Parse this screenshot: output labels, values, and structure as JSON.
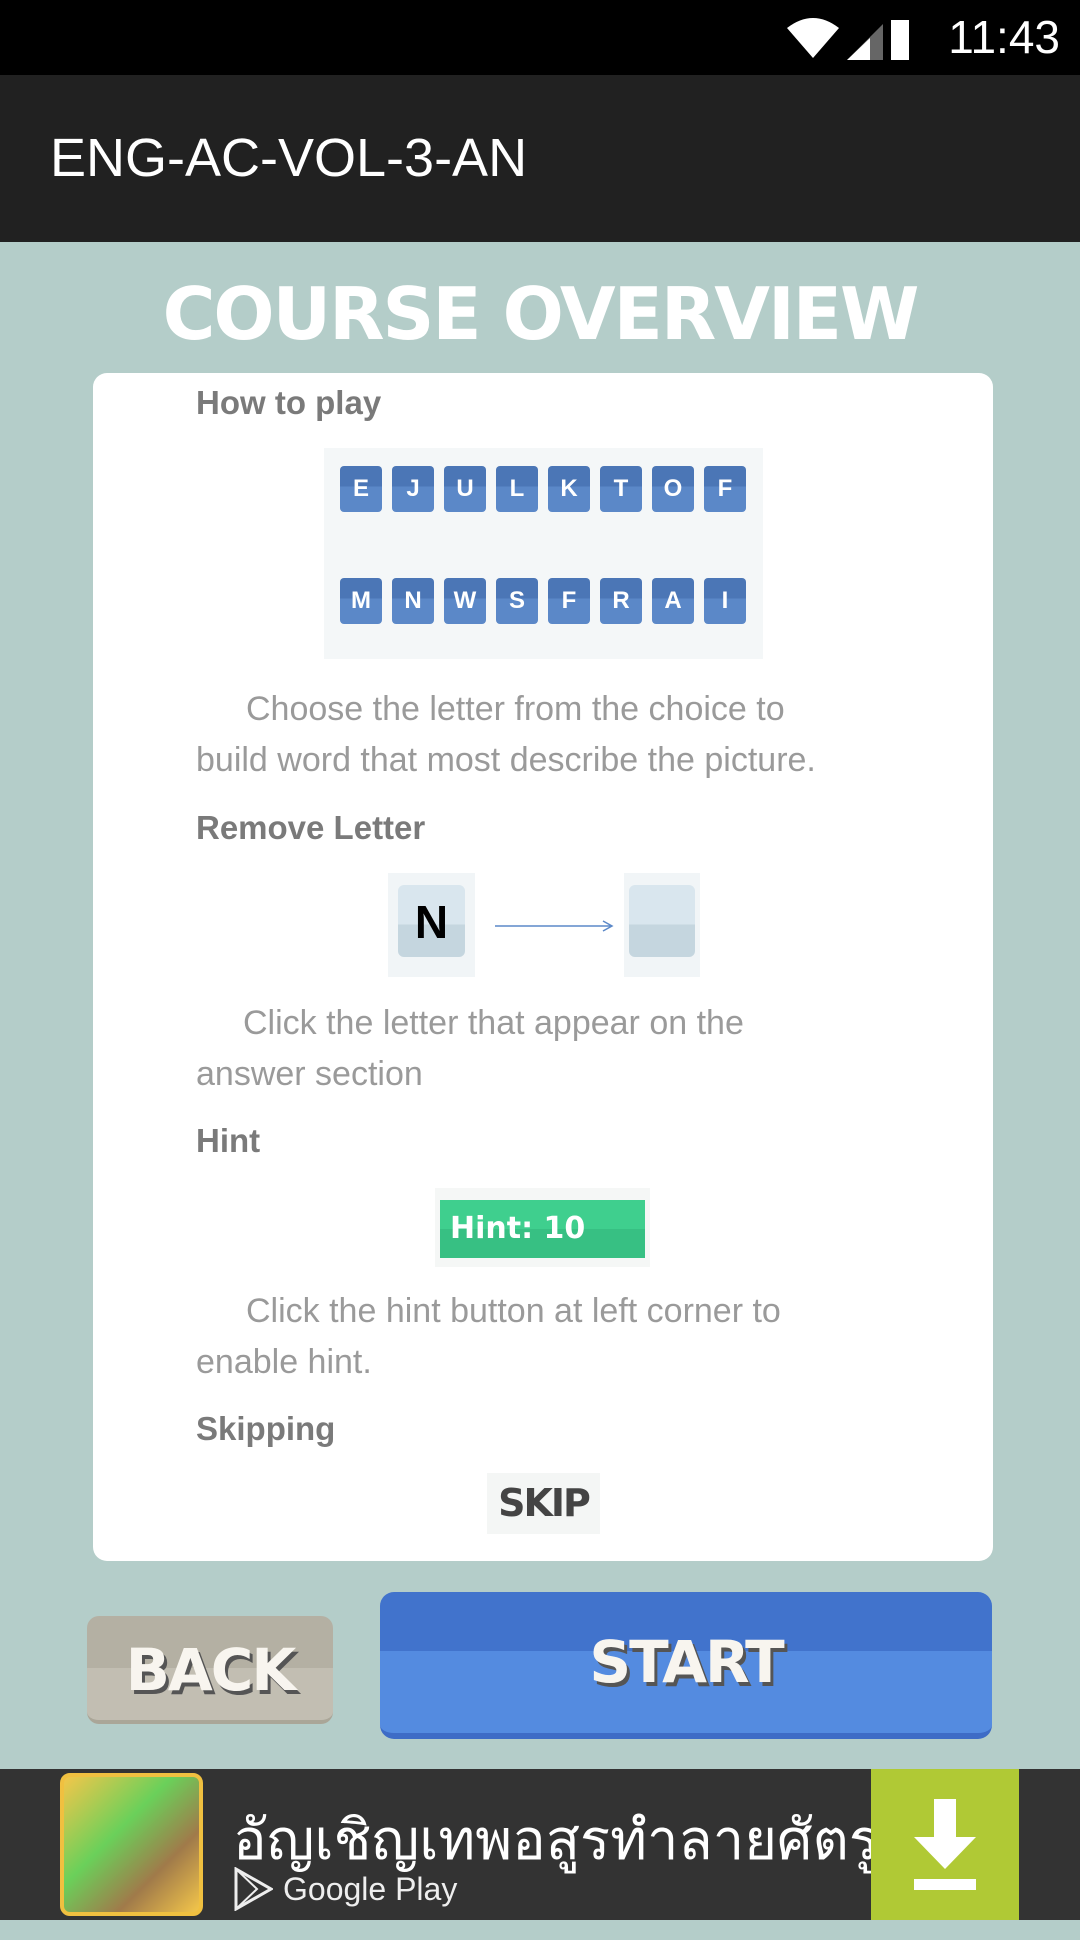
{
  "status_bar": {
    "time": "11:43",
    "icons": [
      "wifi-icon",
      "signal-icon",
      "battery-charging-icon"
    ]
  },
  "app_bar": {
    "title": "ENG-AC-VOL-3-AN"
  },
  "page_title": "COURSE OVERVIEW",
  "sections": [
    {
      "heading": "How to play",
      "letters_row1": [
        "E",
        "J",
        "U",
        "L",
        "K",
        "T",
        "O",
        "F"
      ],
      "letters_row2": [
        "M",
        "N",
        "W",
        "S",
        "F",
        "R",
        "A",
        "I"
      ],
      "text_line1": "Choose the letter from the choice to",
      "text_line2": "build word that most describe the picture."
    },
    {
      "heading": "Remove Letter",
      "letter": "N",
      "text_line1": "Click the letter that appear on the",
      "text_line2": "answer section"
    },
    {
      "heading": "Hint",
      "hint_label": "Hint: 10",
      "text_line1": "Click the hint button at left corner to",
      "text_line2": "enable hint."
    },
    {
      "heading": "Skipping",
      "skip_label": "SKIP"
    }
  ],
  "buttons": {
    "back": "BACK",
    "start": "START"
  },
  "ad": {
    "title": "อัญเชิญเทพอสูรทำลายศัตรู",
    "store": "Google Play",
    "accent": "#b0c935"
  }
}
